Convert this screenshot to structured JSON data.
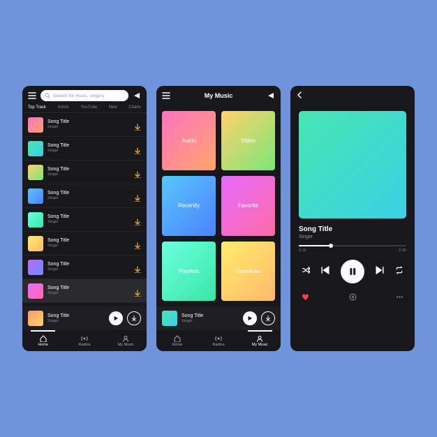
{
  "screen1": {
    "search_placeholder": "Search for music, singers",
    "tabs": [
      "Top Track",
      "Artists",
      "YouTube",
      "New",
      "Charts"
    ],
    "tracks": [
      {
        "title": "Song Title",
        "artist": "Singer",
        "gradient": "g1"
      },
      {
        "title": "Song Title",
        "artist": "Singer",
        "gradient": "g2"
      },
      {
        "title": "Song Title",
        "artist": "Singer",
        "gradient": "g3"
      },
      {
        "title": "Song Title",
        "artist": "Singer",
        "gradient": "g4"
      },
      {
        "title": "Song Title",
        "artist": "Singer",
        "gradient": "g5"
      },
      {
        "title": "Song Title",
        "artist": "Singer",
        "gradient": "g6"
      },
      {
        "title": "Song Title",
        "artist": "Singer",
        "gradient": "g7"
      },
      {
        "title": "Song Title",
        "artist": "Singer",
        "gradient": "g8"
      }
    ],
    "now_playing": {
      "title": "Song Title",
      "artist": "Singer",
      "gradient": "g9"
    },
    "bottom_nav": [
      {
        "label": "Home",
        "icon": "home"
      },
      {
        "label": "Radios",
        "icon": "radio"
      },
      {
        "label": "My Music",
        "icon": "person"
      }
    ]
  },
  "screen2": {
    "title": "My Music",
    "categories": [
      {
        "label": "Audio",
        "gradient": "g1"
      },
      {
        "label": "Video",
        "gradient": "g3"
      },
      {
        "label": "Recently",
        "gradient": "g4"
      },
      {
        "label": "Favorite",
        "gradient": "g8"
      },
      {
        "label": "Playlists",
        "gradient": "g5"
      },
      {
        "label": "Download",
        "gradient": "g6"
      }
    ],
    "now_playing": {
      "title": "Song Title",
      "artist": "Singer",
      "gradient": "g2"
    },
    "bottom_nav": [
      {
        "label": "Home",
        "icon": "home"
      },
      {
        "label": "Radios",
        "icon": "radio"
      },
      {
        "label": "My Music",
        "icon": "person"
      }
    ]
  },
  "screen3": {
    "art_gradient": "g2",
    "song": "Song Title",
    "artist": "Singer",
    "elapsed": "0:15",
    "duration": "2:30",
    "controls": {
      "shuffle": "shuffle",
      "prev": "prev",
      "playpause": "pause",
      "next": "next",
      "repeat": "repeat"
    },
    "secondary": {
      "heart": "heart",
      "add": "plus",
      "more": "more"
    }
  },
  "colors": {
    "accent": "#e8a844",
    "heart": "#ff3b5c",
    "bg": "#18171c"
  }
}
